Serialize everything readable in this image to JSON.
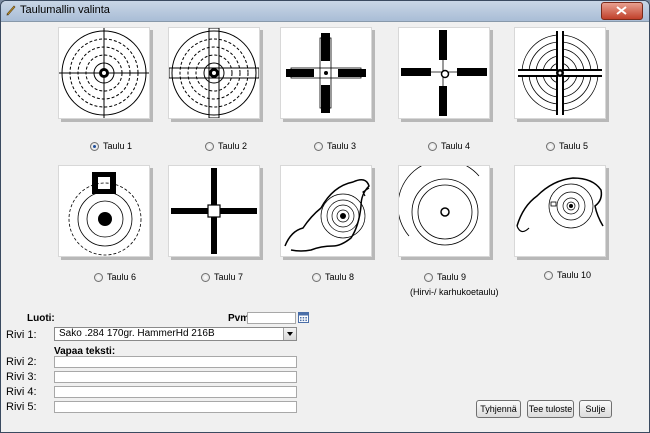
{
  "window": {
    "title": "Taulumallin valinta"
  },
  "targets": [
    {
      "label": "Taulu 1",
      "selected": true
    },
    {
      "label": "Taulu 2",
      "selected": false
    },
    {
      "label": "Taulu 3",
      "selected": false
    },
    {
      "label": "Taulu 4",
      "selected": false
    },
    {
      "label": "Taulu 5",
      "selected": false
    },
    {
      "label": "Taulu 6",
      "selected": false
    },
    {
      "label": "Taulu 7",
      "selected": false
    },
    {
      "label": "Taulu 8",
      "selected": false
    },
    {
      "label": "Taulu 9",
      "sublabel": "(Hirvi-/ karhukoetaulu)",
      "selected": false
    },
    {
      "label": "Taulu 10",
      "selected": false
    }
  ],
  "form": {
    "bullet_label": "Luoti:",
    "date_label": "Pvm",
    "date_value": "",
    "row1_label": "Rivi 1:",
    "row1_value": "Sako .284 170gr. HammerHd  216B",
    "free_text_label": "Vapaa teksti:",
    "rows": [
      {
        "label": "Rivi 2:",
        "value": ""
      },
      {
        "label": "Rivi 3:",
        "value": ""
      },
      {
        "label": "Rivi 4:",
        "value": ""
      },
      {
        "label": "Rivi 5:",
        "value": ""
      }
    ]
  },
  "buttons": {
    "clear": "Tyhjennä",
    "print": "Tee tuloste",
    "close": "Sulje"
  }
}
